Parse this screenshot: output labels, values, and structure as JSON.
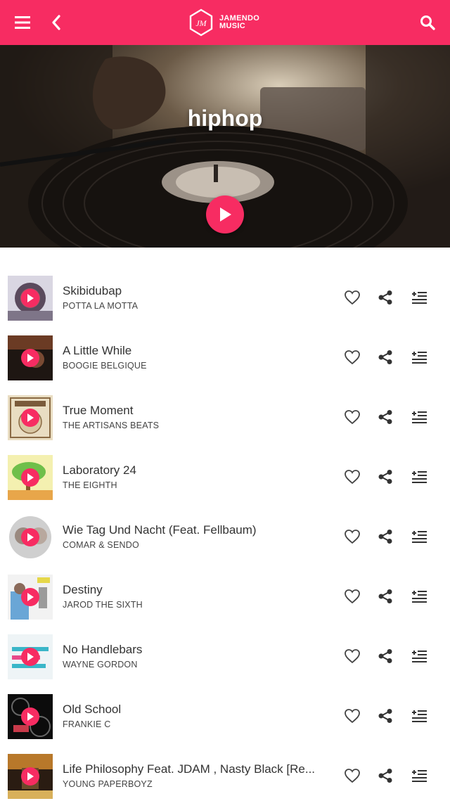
{
  "header": {
    "logo_line1": "JAMENDO",
    "logo_line2": "MUSIC",
    "icons": [
      "menu-icon",
      "back-icon",
      "search-icon"
    ],
    "accent_color": "#f72c62"
  },
  "hero": {
    "title": "hiphop"
  },
  "tracks": [
    {
      "title": "Skibidubap",
      "artist": "POTTA LA MOTTA"
    },
    {
      "title": "A Little While",
      "artist": "BOOGIE BELGIQUE"
    },
    {
      "title": "True Moment",
      "artist": "THE ARTISANS BEATS"
    },
    {
      "title": "Laboratory 24",
      "artist": "THE EIGHTH"
    },
    {
      "title": "Wie Tag Und Nacht (Feat. Fellbaum)",
      "artist": "COMAR & SENDO"
    },
    {
      "title": "Destiny",
      "artist": "JAROD THE SIXTH"
    },
    {
      "title": "No Handlebars",
      "artist": "WAYNE GORDON"
    },
    {
      "title": "Old School",
      "artist": "FRANKIE C"
    },
    {
      "title": "Life Philosophy Feat. JDAM , Nasty Black [Re...",
      "artist": "YOUNG PAPERBOYZ"
    }
  ]
}
